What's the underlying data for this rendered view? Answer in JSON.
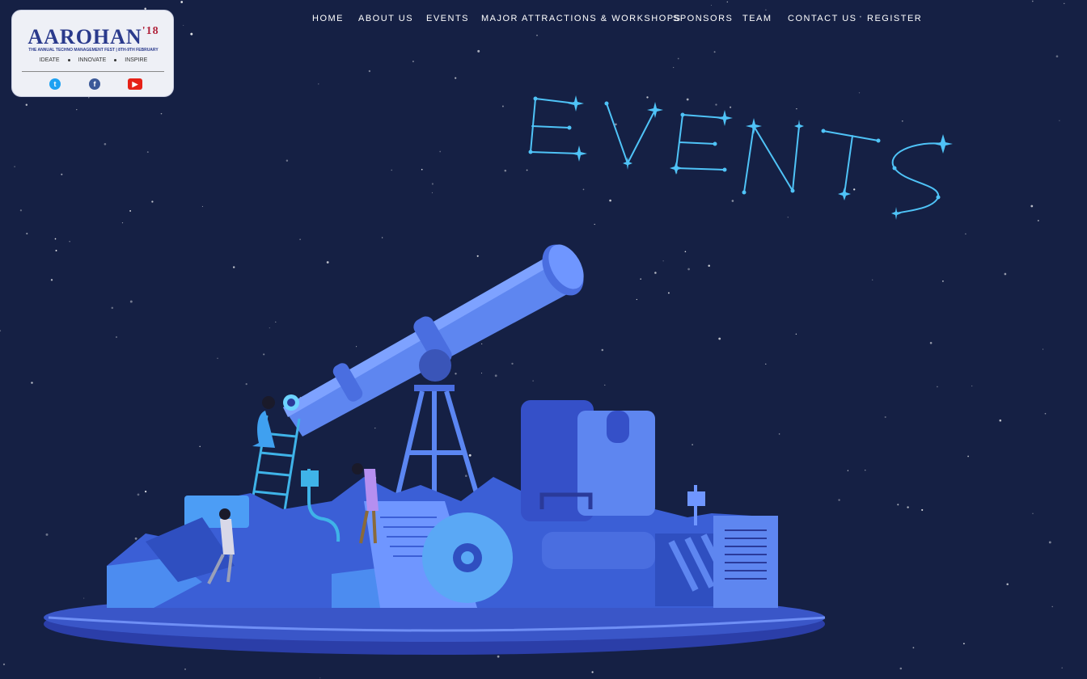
{
  "logo": {
    "name": "AAROHAN",
    "year": "'18",
    "tagline": "THE ANNUAL TECHNO MANAGEMENT FEST | 8TH-9TH FEBRUARY",
    "tags": [
      "IDEATE",
      "INNOVATE",
      "INSPIRE"
    ]
  },
  "social": [
    {
      "icon": "twitter-icon",
      "color": "#1da1f2"
    },
    {
      "icon": "facebook-icon",
      "color": "#3b5998"
    },
    {
      "icon": "youtube-icon",
      "color": "#e62117"
    }
  ],
  "nav": {
    "items": [
      "HOME",
      "ABOUT US",
      "EVENTS",
      "MAJOR ATTRACTIONS & WORKSHOPS",
      "SPONSORS",
      "TEAM",
      "CONTACT US",
      "REGISTER"
    ]
  },
  "page": {
    "heading": "EVENTS"
  },
  "colors": {
    "background": "#152044",
    "constellation": "#4fc3f7",
    "accent_blue": "#5b86f2",
    "logo_text": "#2a3a8c"
  }
}
